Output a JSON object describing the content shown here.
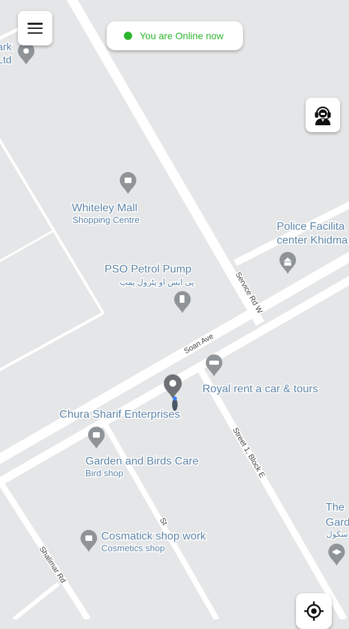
{
  "status": {
    "text": "You are Online now",
    "dot_color": "#2db52d",
    "text_color": "#2db52d"
  },
  "menu_button": {
    "icon": "hamburger-menu-icon"
  },
  "support_button": {
    "icon": "support-agent-icon"
  },
  "locate_button": {
    "icon": "my-location-crosshair-icon"
  },
  "map": {
    "streets": {
      "soan_ave": "Soan Ave",
      "service_rd_w": "Service Rd W",
      "street_1_block_e": "Street 1, Block E",
      "shalimar_rd": "Shalimar Rd",
      "st_partial": "St"
    },
    "places": {
      "edge_top_left": [
        "ark",
        "Ltd"
      ],
      "whiteley_mall": {
        "name": "Whiteley Mall",
        "category": "Shopping Centre"
      },
      "police_center": {
        "line1": "Police Facilita",
        "line2": "center Khidma"
      },
      "pso_pump": {
        "name": "PSO Petrol Pump",
        "urdu": "پی ایس او پٹرول پمپ"
      },
      "royal_rent": {
        "name": "Royal rent a car & tours"
      },
      "chura_sharif": {
        "name": "Chura Sharif Enterprises"
      },
      "garden_birds": {
        "name": "Garden and Birds Care",
        "category": "Bird shop"
      },
      "cosmatick": {
        "name": "Cosmatick shop work",
        "category": "Cosmetics shop"
      },
      "school_edge": {
        "line1": "The",
        "line2": "Gard",
        "urdu": "ن سکول"
      }
    }
  }
}
